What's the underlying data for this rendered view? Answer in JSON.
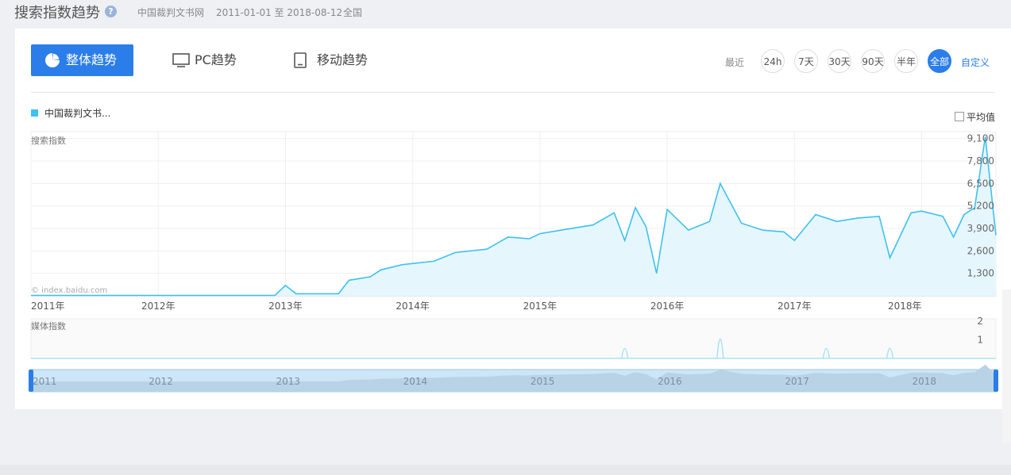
{
  "header": {
    "title": "搜索指数趋势",
    "help_icon": "question-icon",
    "keyword": "中国裁判文书网",
    "date_range": "2011-01-01 至 2018-08-12",
    "region": "全国"
  },
  "tabs": [
    {
      "label": "整体趋势",
      "icon": "pie-chart-icon",
      "active": true
    },
    {
      "label": "PC趋势",
      "icon": "monitor-icon",
      "active": false
    },
    {
      "label": "移动趋势",
      "icon": "mobile-icon",
      "active": false
    }
  ],
  "range": {
    "label": "最近",
    "options": [
      "24h",
      "7天",
      "30天",
      "90天",
      "半年",
      "全部"
    ],
    "selected": "全部",
    "custom": "自定义"
  },
  "legend": {
    "series_label": "中国裁判文书...",
    "color": "#3ec1f0"
  },
  "average_toggle": {
    "label": "平均值",
    "checked": false
  },
  "watermark": "© index.baidu.com",
  "chart_data": [
    {
      "type": "area",
      "title": "搜索指数",
      "series": [
        {
          "name": "中国裁判文书...",
          "color": "#3ec1f0"
        }
      ],
      "x": [
        "2011-01",
        "2011-07",
        "2012-01",
        "2012-07",
        "2012-12",
        "2013-01",
        "2013-02",
        "2013-06",
        "2013-07",
        "2013-09",
        "2013-10",
        "2013-12",
        "2014-03",
        "2014-05",
        "2014-08",
        "2014-10",
        "2014-12",
        "2015-01",
        "2015-03",
        "2015-06",
        "2015-08",
        "2015-09",
        "2015-10",
        "2015-11",
        "2015-12",
        "2016-01",
        "2016-03",
        "2016-05",
        "2016-06",
        "2016-08",
        "2016-10",
        "2016-12",
        "2017-01",
        "2017-03",
        "2017-05",
        "2017-07",
        "2017-09",
        "2017-10",
        "2017-12",
        "2018-01",
        "2018-03",
        "2018-04",
        "2018-05",
        "2018-06",
        "2018-07",
        "2018-08"
      ],
      "y": [
        20,
        20,
        20,
        20,
        20,
        600,
        120,
        120,
        900,
        1100,
        1500,
        1800,
        2000,
        2500,
        2700,
        3400,
        3300,
        3600,
        3800,
        4100,
        4800,
        3200,
        5100,
        4000,
        1300,
        5000,
        3800,
        4300,
        6500,
        4200,
        3800,
        3700,
        3200,
        4700,
        4300,
        4500,
        4600,
        2200,
        4800,
        4900,
        4600,
        3400,
        4700,
        5100,
        9200,
        3500
      ],
      "x_ticks": [
        "2011年",
        "2012年",
        "2013年",
        "2014年",
        "2015年",
        "2016年",
        "2017年",
        "2018年"
      ],
      "y_ticks": [
        1300,
        2600,
        3900,
        5200,
        6500,
        7800,
        9100
      ],
      "ylim": [
        0,
        9500
      ],
      "grid": true
    },
    {
      "type": "line",
      "title": "媒体指数",
      "x": [
        "2015-09",
        "2016-06",
        "2017-04",
        "2017-10"
      ],
      "y": [
        1,
        2,
        1,
        1
      ],
      "y_ticks": [
        1,
        2
      ],
      "ylim": [
        0,
        2
      ]
    }
  ],
  "navigator": {
    "years": [
      "2011",
      "2012",
      "2013",
      "2014",
      "2015",
      "2016",
      "2017",
      "2018"
    ]
  }
}
